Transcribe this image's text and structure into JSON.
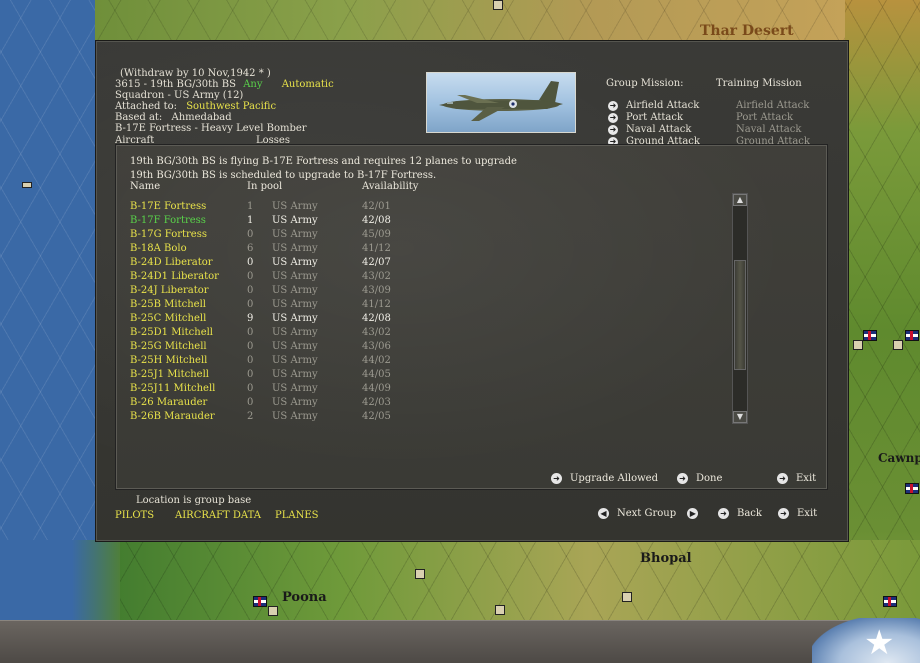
{
  "map": {
    "labels": {
      "thar": "Thar Desert",
      "bhopal": "Bhopal",
      "poona": "Poona",
      "cawnpore": "Cawnp"
    }
  },
  "group": {
    "withdraw": "(Withdraw by 10 Nov,1942 * )",
    "id_name": "3615 - 19th BG/30th BS",
    "any": "Any",
    "automatic": "Automatic",
    "squadron": "Squadron - US Army (12)",
    "attached_label": "Attached to:",
    "attached_value": "Southwest Pacific",
    "based_label": "Based at:",
    "based_value": "Ahmedabad",
    "aircraft_type": "B-17E Fortress - Heavy Level Bomber",
    "aircraft_partial": "Aircraft",
    "losses_partial": "Losses"
  },
  "missions": {
    "group_mission_label": "Group Mission:",
    "training_mission_label": "Training Mission",
    "items": [
      {
        "label": "Airfield Attack",
        "training": "Airfield Attack"
      },
      {
        "label": "Port Attack",
        "training": "Port Attack"
      },
      {
        "label": "Naval Attack",
        "training": "Naval Attack"
      },
      {
        "label": "Ground Attack",
        "training": "Ground Attack"
      }
    ]
  },
  "upgrade": {
    "line1": "19th BG/30th BS is flying B-17E Fortress and requires 12 planes to upgrade",
    "line2": "19th BG/30th BS is scheduled to upgrade to B-17F Fortress.",
    "headers": {
      "name": "Name",
      "pool": "In pool",
      "availability": "Availability"
    },
    "rows": [
      {
        "name": "B-17E Fortress",
        "pool": "1",
        "nation": "US Army",
        "avail": "42/01"
      },
      {
        "name": "B-17F Fortress",
        "pool": "1",
        "nation": "US Army",
        "avail": "42/08"
      },
      {
        "name": "B-17G Fortress",
        "pool": "0",
        "nation": "US Army",
        "avail": "45/09"
      },
      {
        "name": "B-18A Bolo",
        "pool": "6",
        "nation": "US Army",
        "avail": "41/12"
      },
      {
        "name": "B-24D Liberator",
        "pool": "0",
        "nation": "US Army",
        "avail": "42/07"
      },
      {
        "name": "B-24D1 Liberator",
        "pool": "0",
        "nation": "US Army",
        "avail": "43/02"
      },
      {
        "name": "B-24J Liberator",
        "pool": "0",
        "nation": "US Army",
        "avail": "43/09"
      },
      {
        "name": "B-25B Mitchell",
        "pool": "0",
        "nation": "US Army",
        "avail": "41/12"
      },
      {
        "name": "B-25C Mitchell",
        "pool": "9",
        "nation": "US Army",
        "avail": "42/08"
      },
      {
        "name": "B-25D1 Mitchell",
        "pool": "0",
        "nation": "US Army",
        "avail": "43/02"
      },
      {
        "name": "B-25G Mitchell",
        "pool": "0",
        "nation": "US Army",
        "avail": "43/06"
      },
      {
        "name": "B-25H Mitchell",
        "pool": "0",
        "nation": "US Army",
        "avail": "44/02"
      },
      {
        "name": "B-25J1 Mitchell",
        "pool": "0",
        "nation": "US Army",
        "avail": "44/05"
      },
      {
        "name": "B-25J11 Mitchell",
        "pool": "0",
        "nation": "US Army",
        "avail": "44/09"
      },
      {
        "name": "B-26 Marauder",
        "pool": "0",
        "nation": "US Army",
        "avail": "42/03"
      },
      {
        "name": "B-26B Marauder",
        "pool": "2",
        "nation": "US Army",
        "avail": "42/05"
      }
    ],
    "buttons": {
      "upgrade_allowed": "Upgrade Allowed",
      "done": "Done",
      "exit": "Exit"
    }
  },
  "footer": {
    "location_note": "Location is group base",
    "tabs": {
      "pilots": "PILOTS",
      "aircraft_data": "AIRCRAFT DATA",
      "planes": "PLANES"
    },
    "next_group": "Next Group",
    "back": "Back",
    "exit": "Exit"
  },
  "colors": {
    "accent_yellow": "#e8e24a",
    "accent_green": "#59d24a",
    "dialog_bg": "#3a3a37"
  }
}
